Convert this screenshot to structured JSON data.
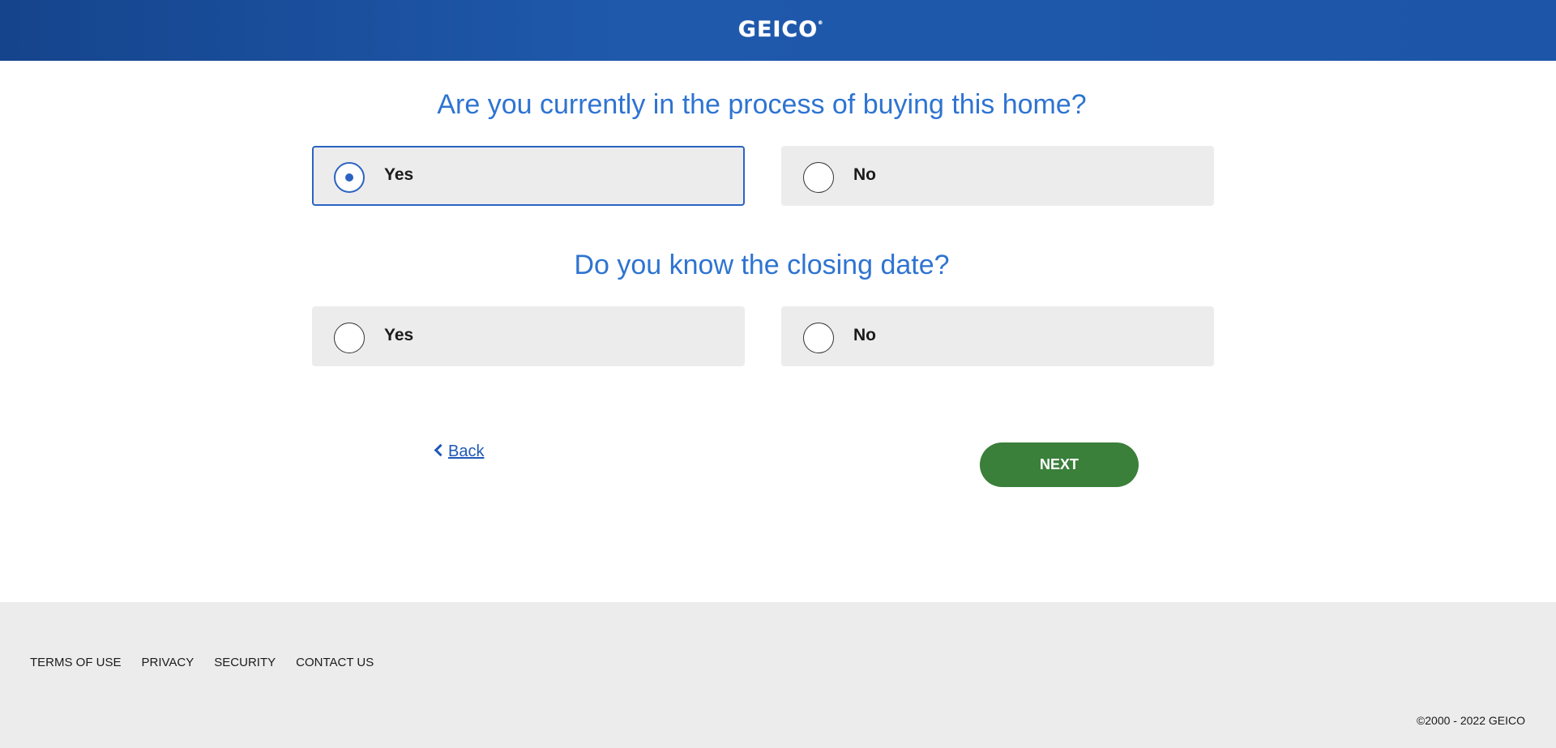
{
  "header": {
    "logo_text": "GEICO",
    "logo_mark": "®"
  },
  "questions": [
    {
      "text": "Are you currently in the process of buying this home?",
      "options": [
        {
          "label": "Yes",
          "selected": true
        },
        {
          "label": "No",
          "selected": false
        }
      ]
    },
    {
      "text": "Do you know the closing date?",
      "options": [
        {
          "label": "Yes",
          "selected": false
        },
        {
          "label": "No",
          "selected": false
        }
      ]
    }
  ],
  "nav": {
    "back_label": "Back",
    "next_label": "NEXT"
  },
  "footer": {
    "links": [
      "TERMS OF USE",
      "PRIVACY",
      "SECURITY",
      "CONTACT US"
    ],
    "copyright": "©2000 - 2022  GEICO"
  },
  "colors": {
    "header_blue": "#1f59ac",
    "question_blue": "#2e74d1",
    "radio_blue": "#2b63c2",
    "next_green": "#3a7f3a",
    "option_bg": "#ececec",
    "footer_bg": "#ececec"
  },
  "icons": [
    "chevron-left-icon"
  ]
}
